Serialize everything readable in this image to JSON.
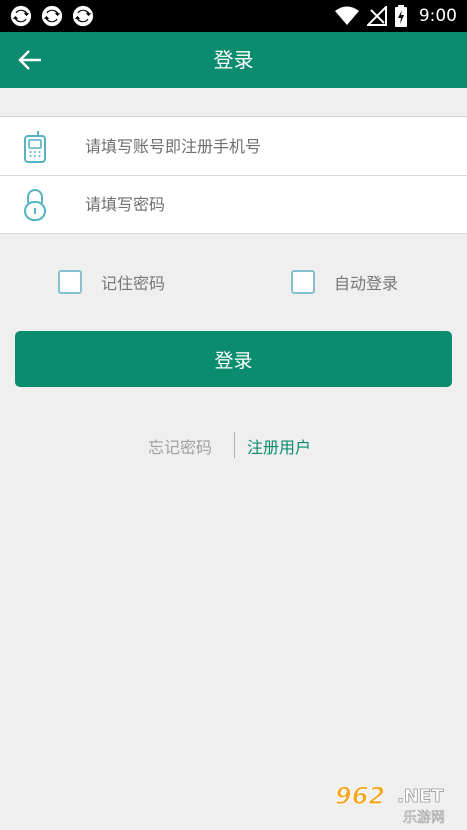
{
  "status_bar": {
    "time": "9:00",
    "icons": [
      "sync-icon",
      "sync-icon",
      "sync-icon",
      "wifi-icon",
      "no-signal-icon",
      "battery-charging-icon"
    ]
  },
  "header": {
    "title": "登录",
    "back_icon": "arrow-left-icon"
  },
  "form": {
    "account_placeholder": "请填写账号即注册手机号",
    "account_value": "",
    "password_placeholder": "请填写密码",
    "password_value": "",
    "account_icon": "phone-icon",
    "password_icon": "lock-icon"
  },
  "options": {
    "remember_label": "记住密码",
    "remember_checked": false,
    "autologin_label": "自动登录",
    "autologin_checked": false
  },
  "actions": {
    "login_label": "登录",
    "forgot_label": "忘记密码",
    "register_label": "注册用户"
  },
  "watermark": {
    "number": "962",
    "suffix": ".NET",
    "caption": "乐游网"
  },
  "colors": {
    "primary": "#0b8c6e",
    "background": "#efefef",
    "checkbox_border": "#86bfcf",
    "icon_teal": "#56b3c2"
  }
}
